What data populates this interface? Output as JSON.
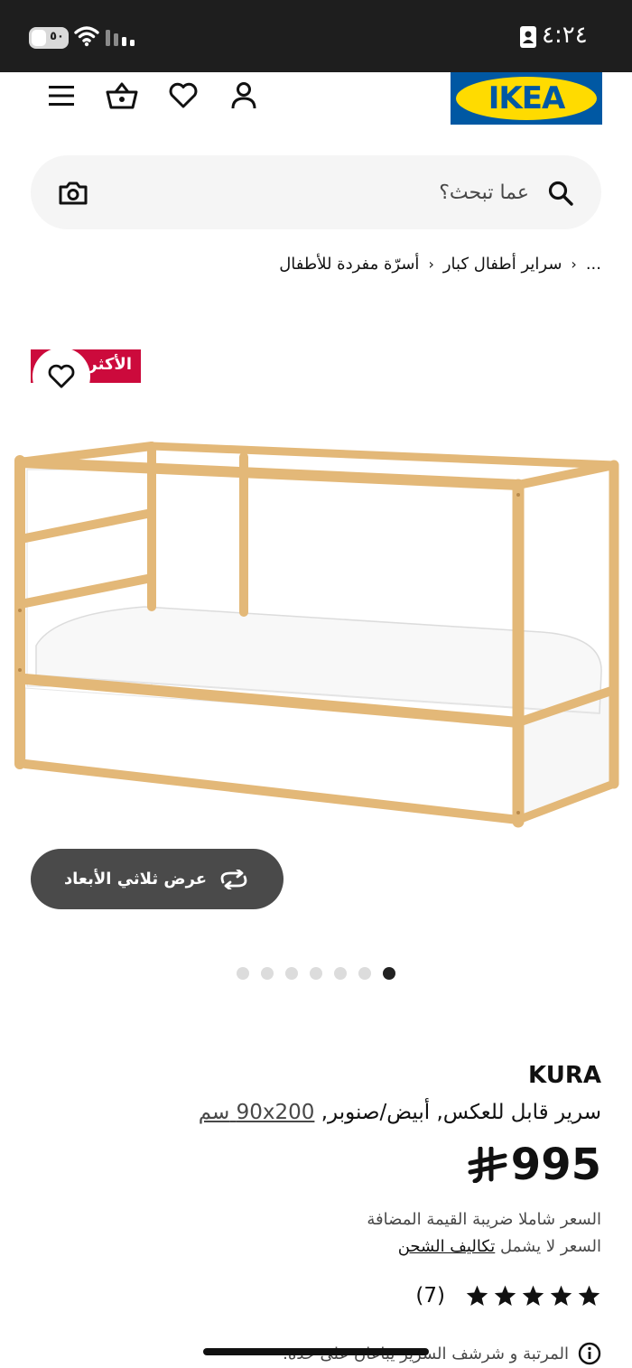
{
  "status_bar": {
    "time": "٤:٢٤",
    "battery": "٥٠"
  },
  "header": {
    "logo_text": "IKEA"
  },
  "search": {
    "placeholder": "عما تبحث؟"
  },
  "breadcrumb": {
    "items": [
      "...",
      "سراير أطفال كبار",
      "أسرّة مفردة للأطفال"
    ]
  },
  "badge": {
    "label": "الأكثر"
  },
  "view_3d": {
    "label": "عرض ثلاثي الأبعاد"
  },
  "gallery": {
    "image_count": 7,
    "active_index": 6
  },
  "product": {
    "name": "KURA",
    "description": "سرير قابل للعكس, أبيض/صنوبر,",
    "size": "90x200",
    "size_unit": "سم",
    "price": "995",
    "price_note_vat": "السعر شاملا ضريبة القيمة المضافة",
    "price_note_shipping_prefix": "السعر لا يشمل",
    "price_note_shipping_link": "تكاليف الشحن",
    "rating_stars": 5,
    "rating_count": "(7)",
    "info_text": "المرتبة و شرشف السرير يباعان على حدة."
  },
  "colors": {
    "status_bar": "#1e1e1e",
    "ikea_blue": "#0058a3",
    "ikea_yellow": "#ffdb00",
    "badge_red": "#cc0a3c",
    "pine": "#e6c08a"
  },
  "icons": [
    "menu-icon",
    "basket-icon",
    "heart-icon",
    "user-icon",
    "search-icon",
    "camera-icon",
    "rotate-3d-icon",
    "star-icon",
    "info-icon"
  ]
}
